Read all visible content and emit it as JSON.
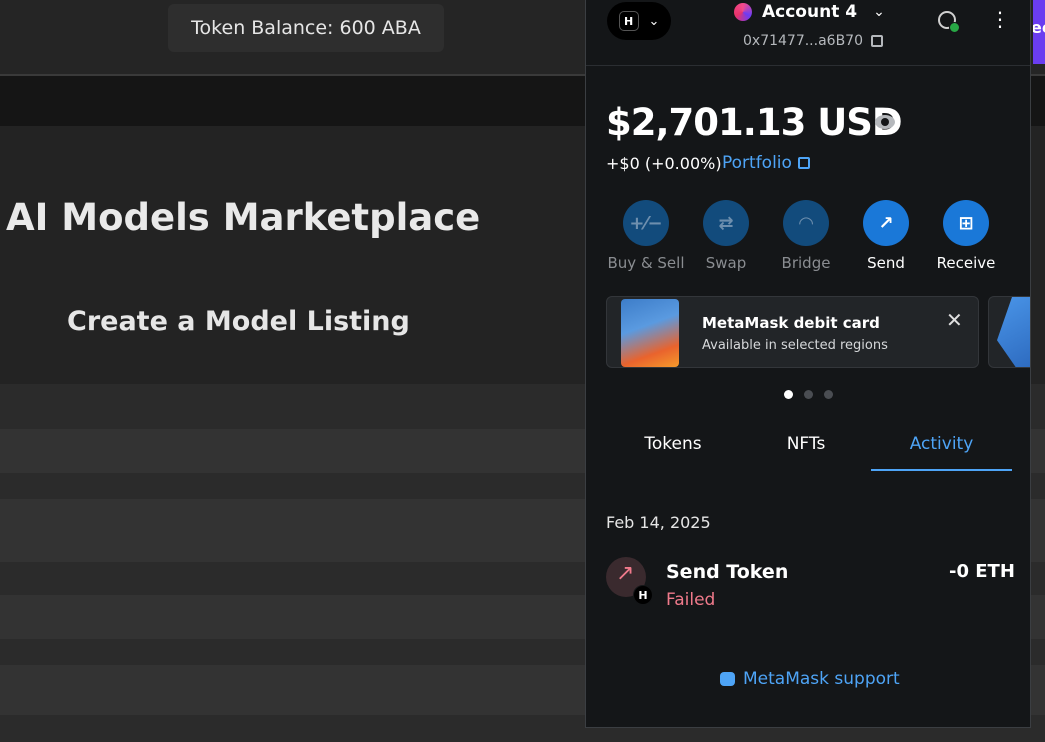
{
  "dapp": {
    "token_balance": "Token Balance: 600 ABA",
    "title": "AI Models Marketplace",
    "subtitle": "Create a Model Listing",
    "edge_text": "ect"
  },
  "metamask": {
    "network_badge": "H",
    "account_name": "Account 4",
    "account_address": "0x71477...a6B70",
    "total_balance": "$2,701.13 USD",
    "change": "+$0 (+0.00%)",
    "portfolio_label": "Portfolio",
    "actions": [
      {
        "label": "Buy & Sell",
        "icon": "buy-sell-icon",
        "glyph": "+⁄−",
        "enabled": false
      },
      {
        "label": "Swap",
        "icon": "swap-icon",
        "glyph": "⇄",
        "enabled": false
      },
      {
        "label": "Bridge",
        "icon": "bridge-icon",
        "glyph": "◠",
        "enabled": false
      },
      {
        "label": "Send",
        "icon": "send-arrow-icon",
        "glyph": "↗",
        "enabled": true
      },
      {
        "label": "Receive",
        "icon": "qr-icon",
        "glyph": "⊞",
        "enabled": true
      }
    ],
    "promo_card": {
      "title": "MetaMask debit card",
      "subtitle": "Available in selected regions"
    },
    "carousel_active_index": 0,
    "carousel_count": 3,
    "tabs": [
      {
        "label": "Tokens",
        "active": false
      },
      {
        "label": "NFTs",
        "active": false
      },
      {
        "label": "Activity",
        "active": true
      }
    ],
    "activity": {
      "date": "Feb 14, 2025",
      "tx_title": "Send Token",
      "tx_status": "Failed",
      "tx_amount": "-0 ETH",
      "tx_badge": "H"
    },
    "support_label": "MetaMask support"
  },
  "colors": {
    "accent_blue": "#4ea4f6",
    "button_blue": "#1a78d8",
    "error_red": "#f07a8b",
    "popup_bg": "#141618",
    "page_bg": "#2a2a2a"
  }
}
